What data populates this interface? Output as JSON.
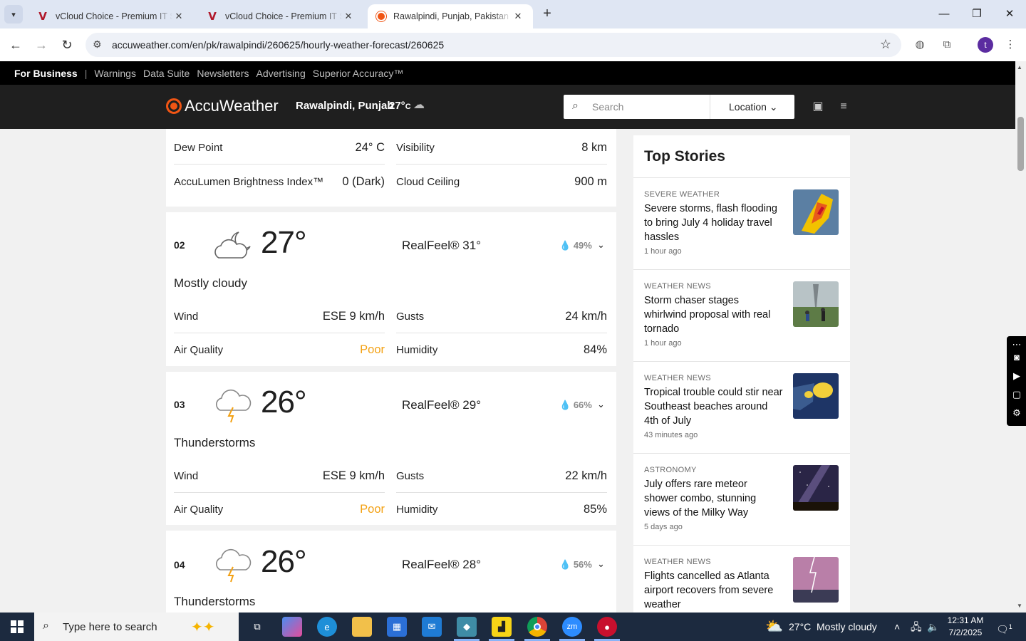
{
  "browser": {
    "tabs": [
      {
        "title": "vCloud Choice - Premium IT Sol",
        "icon": "vcloud-icon",
        "active": false
      },
      {
        "title": "vCloud Choice - Premium IT Sol",
        "icon": "vcloud-icon",
        "active": false
      },
      {
        "title": "Rawalpindi, Punjab, Pakistan Ho",
        "icon": "accuweather-icon",
        "active": true
      }
    ],
    "url": "accuweather.com/en/pk/rawalpindi/260625/hourly-weather-forecast/260625",
    "avatar_letter": "t"
  },
  "site": {
    "business_bar": {
      "brand": "For Business",
      "separator": "|",
      "links": [
        "Warnings",
        "Data Suite",
        "Newsletters",
        "Advertising",
        "Superior Accuracy™"
      ]
    },
    "logo_text": "AccuWeather",
    "location": "Rawalpindi, Punjab",
    "current_temp": "27°",
    "current_unit": "C",
    "search_placeholder": "Search",
    "location_button": "Location",
    "brand_color": "#f05514"
  },
  "prev_card": {
    "rows": [
      {
        "l_label": "Dew Point",
        "l_value": "24° C",
        "r_label": "Visibility",
        "r_value": "8 km"
      },
      {
        "l_label": "AccuLumen Brightness Index™",
        "l_value": "0 (Dark)",
        "r_label": "Cloud Ceiling",
        "r_value": "900 m"
      }
    ]
  },
  "hours": [
    {
      "hour": "02",
      "icon": "mostly-cloudy-night-icon",
      "temp": "27°",
      "realfeel": "RealFeel® 31°",
      "precip": "49%",
      "phrase": "Mostly cloudy",
      "wind_label": "Wind",
      "wind": "ESE 9 km/h",
      "gusts_label": "Gusts",
      "gusts": "24 km/h",
      "aq_label": "Air Quality",
      "aq": "Poor",
      "humidity_label": "Humidity",
      "humidity": "84%"
    },
    {
      "hour": "03",
      "icon": "thunderstorm-icon",
      "temp": "26°",
      "realfeel": "RealFeel® 29°",
      "precip": "66%",
      "phrase": "Thunderstorms",
      "wind_label": "Wind",
      "wind": "ESE 9 km/h",
      "gusts_label": "Gusts",
      "gusts": "22 km/h",
      "aq_label": "Air Quality",
      "aq": "Poor",
      "humidity_label": "Humidity",
      "humidity": "85%"
    },
    {
      "hour": "04",
      "icon": "thunderstorm-icon",
      "temp": "26°",
      "realfeel": "RealFeel® 28°",
      "precip": "56%",
      "phrase": "Thunderstorms"
    }
  ],
  "top_stories": {
    "title": "Top Stories",
    "items": [
      {
        "category": "SEVERE WEATHER",
        "headline": "Severe storms, flash flooding to bring July 4 holiday travel hassles",
        "age": "1 hour ago"
      },
      {
        "category": "WEATHER NEWS",
        "headline": "Storm chaser stages whirlwind proposal with real tornado",
        "age": "1 hour ago"
      },
      {
        "category": "WEATHER NEWS",
        "headline": "Tropical trouble could stir near Southeast beaches around 4th of July",
        "age": "43 minutes ago"
      },
      {
        "category": "ASTRONOMY",
        "headline": "July offers rare meteor shower combo, stunning views of the Milky Way",
        "age": "5 days ago"
      },
      {
        "category": "WEATHER NEWS",
        "headline": "Flights cancelled as Atlanta airport recovers from severe weather",
        "age": ""
      }
    ]
  },
  "taskbar": {
    "search_placeholder": "Type here to search",
    "weather_temp": "27°C",
    "weather_text": "Mostly cloudy",
    "time": "12:31 AM",
    "date": "7/2/2025",
    "notification_count": "1"
  }
}
